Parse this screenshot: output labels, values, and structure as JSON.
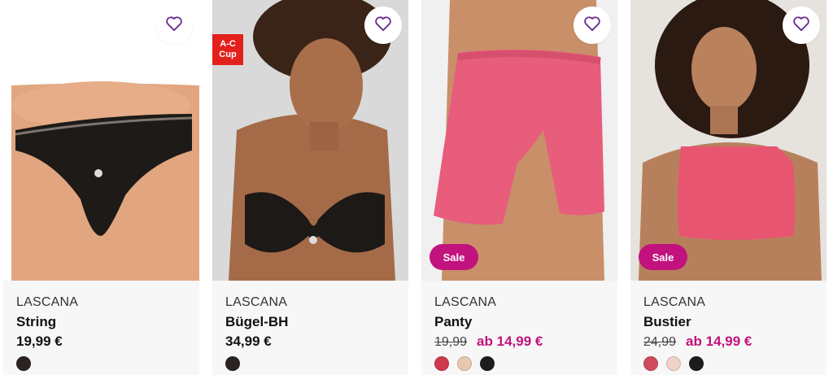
{
  "products": [
    {
      "brand": "LASCANA",
      "name": "String",
      "price": "19,99 €",
      "swatches": [
        "#2a2320"
      ]
    },
    {
      "brand": "LASCANA",
      "name": "Bügel-BH",
      "price": "34,99 €",
      "badge_line1": "A-C",
      "badge_line2": "Cup",
      "swatches": [
        "#2a2320"
      ]
    },
    {
      "brand": "LASCANA",
      "name": "Panty",
      "old_price": "19,99",
      "price": "ab 14,99 €",
      "sale_label": "Sale",
      "swatches": [
        "#d0384f",
        "#e7c9ad",
        "#1c1c1c"
      ]
    },
    {
      "brand": "LASCANA",
      "name": "Bustier",
      "old_price": "24,99",
      "price": "ab 14,99 €",
      "sale_label": "Sale",
      "swatches": [
        "#cf4a5e",
        "#f1d2c9",
        "#1c1c1c"
      ]
    }
  ],
  "colors": {
    "accent": "#c2127d",
    "heart": "#6a2c91",
    "badge_red": "#e3201b"
  }
}
